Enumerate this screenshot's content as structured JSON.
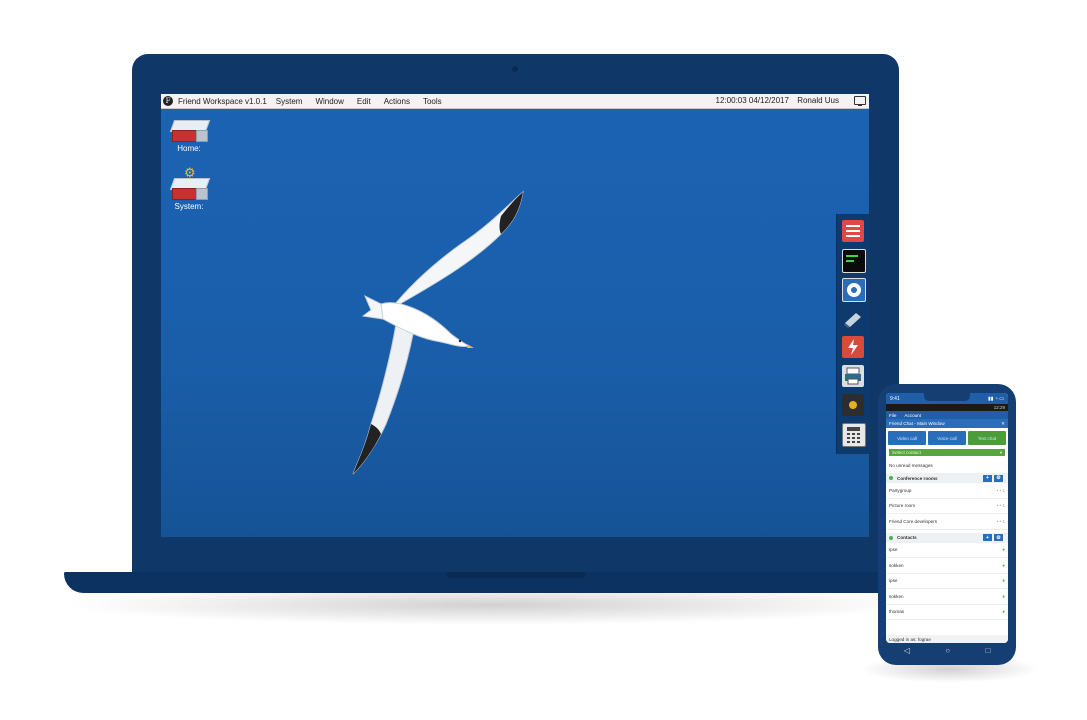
{
  "menubar": {
    "title": "Friend Workspace v1.0.1",
    "menus": [
      "System",
      "Window",
      "Edit",
      "Actions",
      "Tools"
    ],
    "clock": "12:00:03 04/12/2017",
    "user": "Ronald Uus"
  },
  "desktop": {
    "icons": [
      {
        "label": "Home:",
        "icon": "drive-icon"
      },
      {
        "label": "System:",
        "icon": "system-drive-icon"
      }
    ]
  },
  "dock": {
    "items": [
      "list-app-icon",
      "terminal-icon",
      "media-icon",
      "tools-icon",
      "flash-icon",
      "printer-icon",
      "video-icon",
      "calculator-icon"
    ]
  },
  "phone": {
    "time": "9:41",
    "status_time": "12:29",
    "menu": [
      "File",
      "Account"
    ],
    "window_title": "Friend Chat - Main Window",
    "buttons": [
      "Video call",
      "Voice call",
      "Text chat"
    ],
    "select_placeholder": "Select contact",
    "no_messages": "No unread messages",
    "conference_header": "Conference rooms",
    "rooms": [
      "Partygroup",
      "Picture room",
      "Friend Core developers"
    ],
    "contacts_header": "Contacts",
    "contacts": [
      "ipse",
      "sokken",
      "ipse",
      "sokken",
      "thomas"
    ],
    "footer": "Logged in as: fograe"
  },
  "colors": {
    "laptop_body": "#0f3869",
    "desktop_bg": "#1a5ea9",
    "accent_blue": "#2a6dbb",
    "accent_green": "#58a540"
  }
}
